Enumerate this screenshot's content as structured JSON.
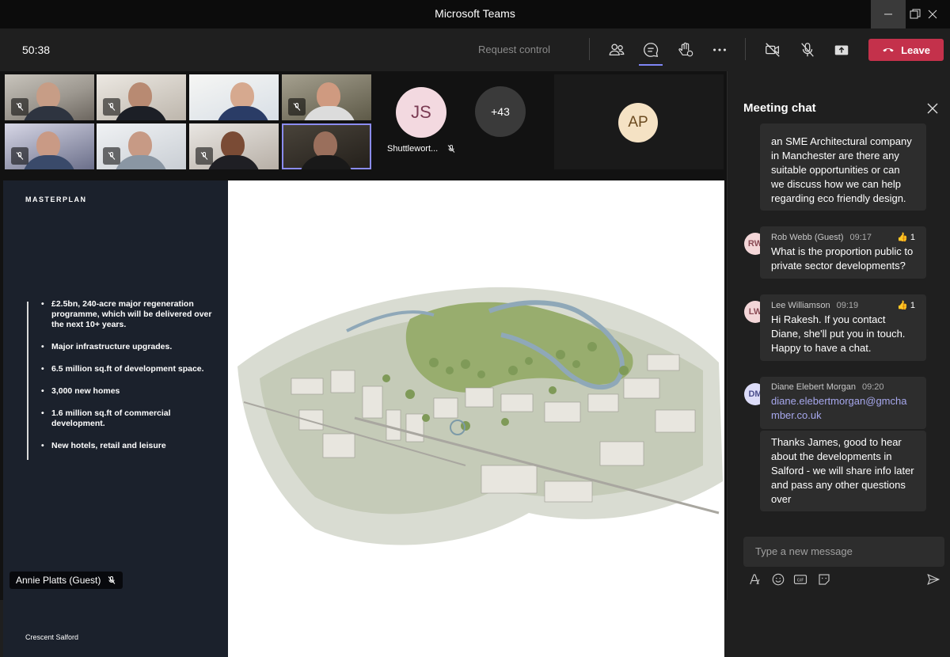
{
  "window": {
    "title": "Microsoft Teams"
  },
  "toolbar": {
    "timer": "50:38",
    "request_control": "Request control",
    "leave_label": "Leave"
  },
  "participants": {
    "overflow_count": "+43",
    "js_initials": "JS",
    "js_name": "Shuttlewort...",
    "ap_initials": "AP"
  },
  "slide": {
    "title": "MASTERPLAN",
    "bullets": [
      "£2.5bn, 240-acre major regeneration programme, which will be delivered over the next 10+ years.",
      "Major infrastructure upgrades.",
      "6.5 million sq.ft of development space.",
      "3,000 new homes",
      "1.6 million sq.ft of commercial development.",
      "New hotels, retail and leisure"
    ],
    "footer": "Crescent Salford"
  },
  "presenter": {
    "name": "Annie Platts (Guest)"
  },
  "chat": {
    "title": "Meeting chat",
    "first_message_text": "an SME Architectural company in Manchester are there any suitable opportunities or can we discuss how we can help regarding eco friendly design.",
    "messages": [
      {
        "initials": "RW",
        "author": "Rob Webb (Guest)",
        "time": "09:17",
        "reaction": "👍 1",
        "text": "What is the proportion public to private sector developments?"
      },
      {
        "initials": "LW",
        "author": "Lee Williamson",
        "time": "09:19",
        "reaction": "👍 1",
        "text": "Hi Rakesh. If you contact Diane, she'll put you in touch. Happy to have a chat."
      },
      {
        "initials": "DM",
        "author": "Diane Elebert Morgan",
        "time": "09:20",
        "reaction": "",
        "text": "diane.elebertmorgan@gmchamber.co.uk"
      }
    ],
    "follow_up_text": "Thanks James, good to hear about the developments in Salford - we will share info later and pass any other questions over",
    "compose_placeholder": "Type a new message"
  },
  "colors": {
    "leave": "#c4314b",
    "accent": "#7f85f5",
    "link": "#a6a7ec"
  }
}
